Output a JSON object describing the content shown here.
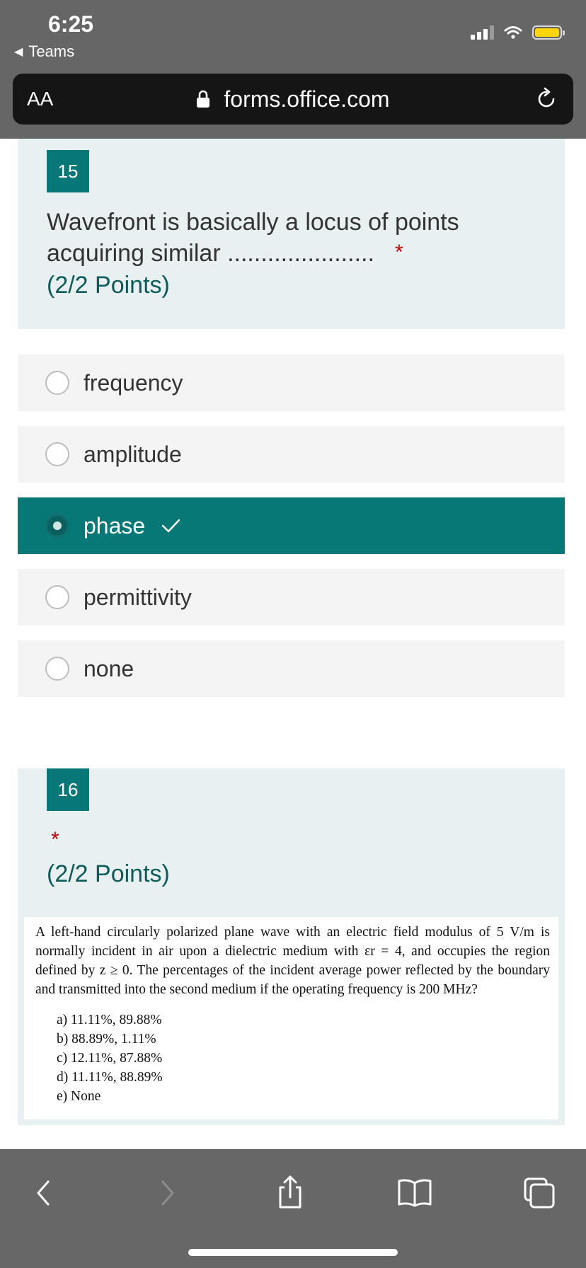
{
  "status": {
    "time": "6:25",
    "back_app": "Teams"
  },
  "browser": {
    "text_size": "AA",
    "url": "forms.office.com"
  },
  "q15": {
    "number": "15",
    "text": "Wavefront is basically a locus of points acquiring similar ......................",
    "required_mark": "*",
    "points": "(2/2 Points)",
    "options": [
      {
        "label": "frequency",
        "selected": false
      },
      {
        "label": "amplitude",
        "selected": false
      },
      {
        "label": "phase",
        "selected": true
      },
      {
        "label": "permittivity",
        "selected": false
      },
      {
        "label": "none",
        "selected": false
      }
    ]
  },
  "q16": {
    "number": "16",
    "required_mark": "*",
    "points": "(2/2 Points)",
    "image_text": "A left-hand circularly polarized plane wave with an electric field modulus of 5 V/m is normally incident in air upon a dielectric medium with εr = 4, and occupies the region defined by z ≥ 0. The percentages of the incident average power reflected by the boundary and transmitted into the second medium if the operating frequency is 200 MHz?",
    "image_choices": [
      "a) 11.11%, 89.88%",
      "b) 88.89%, 1.11%",
      "c) 12.11%, 87.88%",
      "d) 11.11%, 88.89%",
      "e) None"
    ]
  },
  "colors": {
    "accent": "#077877",
    "card_bg": "#e8f0f2",
    "option_bg": "#f4f4f4",
    "required": "#c00000"
  }
}
